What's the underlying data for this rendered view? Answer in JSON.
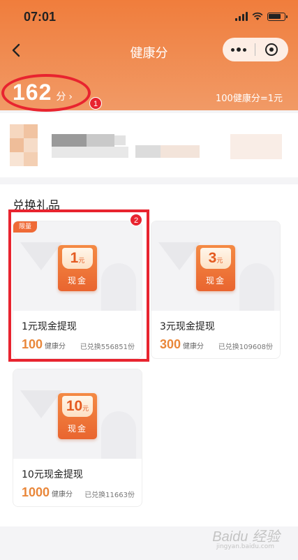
{
  "status_bar": {
    "time": "07:01"
  },
  "nav": {
    "title": "健康分",
    "back_icon": "chevron-left-icon"
  },
  "score": {
    "value": "162",
    "unit": "分",
    "arrow": "›",
    "rate": "100健康分=1元"
  },
  "annotations": {
    "badge1": "1",
    "badge2": "2"
  },
  "gifts": {
    "title": "兑换礼品",
    "items": [
      {
        "tag": "限量",
        "amount": "1",
        "amount_unit": "元",
        "cash": "现金",
        "name": "1元现金提现",
        "points": "100",
        "points_unit": "健康分",
        "redeemed": "已兑换556851份"
      },
      {
        "amount": "3",
        "amount_unit": "元",
        "cash": "现金",
        "name": "3元现金提现",
        "points": "300",
        "points_unit": "健康分",
        "redeemed": "已兑换109608份"
      },
      {
        "amount": "10",
        "amount_unit": "元",
        "cash": "现金",
        "name": "10元现金提现",
        "points": "1000",
        "points_unit": "健康分",
        "redeemed": "已兑换11663份"
      }
    ]
  },
  "watermark": {
    "text": "Baidu 经验",
    "sub": "jingyan.baidu.com"
  },
  "colors": {
    "header": "#f07d3c",
    "accent": "#e9873a",
    "highlight": "#e8242f"
  }
}
